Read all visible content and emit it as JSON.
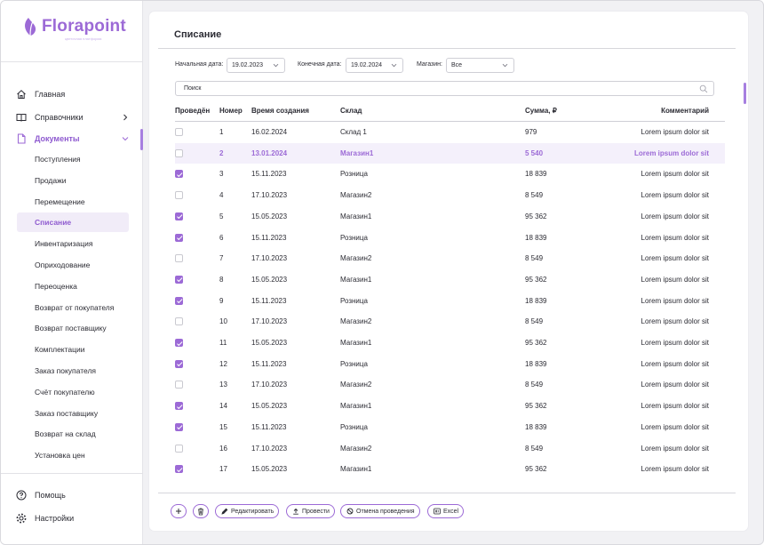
{
  "brand": {
    "name": "Florapoint",
    "tagline": "цветочная платформа"
  },
  "sidebar": {
    "home": "Главная",
    "directories": "Справочники",
    "documents": "Документы",
    "sub_items": [
      "Поступления",
      "Продажи",
      "Перемещение",
      "Списание",
      "Инвентаризация",
      "Оприходование",
      "Переоценка",
      "Возврат от покупателя",
      "Возврат поставщику",
      "Комплектации",
      "Заказ покупателя",
      "Счёт покупателю",
      "Заказ поставщику",
      "Возврат на склад",
      "Установка цен"
    ],
    "active_sub": "Списание",
    "help": "Помощь",
    "settings": "Настройки"
  },
  "page": {
    "title": "Списание",
    "filters": {
      "start_label": "Начальная дата:",
      "start_value": "19.02.2023",
      "end_label": "Конечная дата:",
      "end_value": "19.02.2024",
      "store_label": "Магазин:",
      "store_value": "Все"
    },
    "search_placeholder": "Поиск"
  },
  "table": {
    "columns": [
      "Проведён",
      "Номер",
      "Время создания",
      "Склад",
      "Сумма, ₽",
      "Комментарий"
    ],
    "rows": [
      {
        "checked": false,
        "num": "1",
        "date": "16.02.2024",
        "warehouse": "Склад 1",
        "sum": "979",
        "comment": "Lorem ipsum dolor sit"
      },
      {
        "checked": false,
        "num": "2",
        "date": "13.01.2024",
        "warehouse": "Магазин1",
        "sum": "5 540",
        "comment": "Lorem ipsum dolor sit",
        "selected": true
      },
      {
        "checked": true,
        "num": "3",
        "date": "15.11.2023",
        "warehouse": "Розница",
        "sum": "18 839",
        "comment": "Lorem ipsum dolor sit"
      },
      {
        "checked": false,
        "num": "4",
        "date": "17.10.2023",
        "warehouse": "Магазин2",
        "sum": "8 549",
        "comment": "Lorem ipsum dolor sit"
      },
      {
        "checked": true,
        "num": "5",
        "date": "15.05.2023",
        "warehouse": "Магазин1",
        "sum": "95 362",
        "comment": "Lorem ipsum dolor sit"
      },
      {
        "checked": true,
        "num": "6",
        "date": "15.11.2023",
        "warehouse": "Розница",
        "sum": "18 839",
        "comment": "Lorem ipsum dolor sit"
      },
      {
        "checked": false,
        "num": "7",
        "date": "17.10.2023",
        "warehouse": "Магазин2",
        "sum": "8 549",
        "comment": "Lorem ipsum dolor sit"
      },
      {
        "checked": true,
        "num": "8",
        "date": "15.05.2023",
        "warehouse": "Магазин1",
        "sum": "95 362",
        "comment": "Lorem ipsum dolor sit"
      },
      {
        "checked": true,
        "num": "9",
        "date": "15.11.2023",
        "warehouse": "Розница",
        "sum": "18 839",
        "comment": "Lorem ipsum dolor sit"
      },
      {
        "checked": false,
        "num": "10",
        "date": "17.10.2023",
        "warehouse": "Магазин2",
        "sum": "8 549",
        "comment": "Lorem ipsum dolor sit"
      },
      {
        "checked": true,
        "num": "11",
        "date": "15.05.2023",
        "warehouse": "Магазин1",
        "sum": "95 362",
        "comment": "Lorem ipsum dolor sit"
      },
      {
        "checked": true,
        "num": "12",
        "date": "15.11.2023",
        "warehouse": "Розница",
        "sum": "18 839",
        "comment": "Lorem ipsum dolor sit"
      },
      {
        "checked": false,
        "num": "13",
        "date": "17.10.2023",
        "warehouse": "Магазин2",
        "sum": "8 549",
        "comment": "Lorem ipsum dolor sit"
      },
      {
        "checked": true,
        "num": "14",
        "date": "15.05.2023",
        "warehouse": "Магазин1",
        "sum": "95 362",
        "comment": "Lorem ipsum dolor sit"
      },
      {
        "checked": true,
        "num": "15",
        "date": "15.11.2023",
        "warehouse": "Розница",
        "sum": "18 839",
        "comment": "Lorem ipsum dolor sit"
      },
      {
        "checked": false,
        "num": "16",
        "date": "17.10.2023",
        "warehouse": "Магазин2",
        "sum": "8 549",
        "comment": "Lorem ipsum dolor sit"
      },
      {
        "checked": true,
        "num": "17",
        "date": "15.05.2023",
        "warehouse": "Магазин1",
        "sum": "95 362",
        "comment": "Lorem ipsum dolor sit"
      }
    ]
  },
  "toolbar": {
    "add_icon": "plus-icon",
    "delete_icon": "trash-icon",
    "edit_label": "Редактировать",
    "post_label": "Провести",
    "unpost_label": "Отмена проведения",
    "excel_label": "Excel"
  },
  "colors": {
    "accent": "#9c6ad6",
    "selected_row": "#f4f0fb"
  }
}
